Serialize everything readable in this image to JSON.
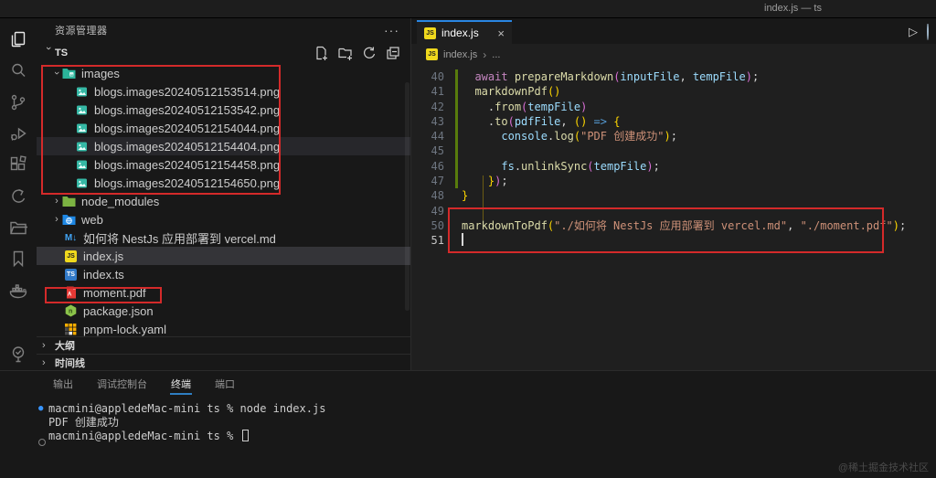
{
  "titlebar": {
    "title": "index.js — ts"
  },
  "activity_bar": {
    "items": [
      {
        "name": "explorer",
        "active": true
      },
      {
        "name": "search"
      },
      {
        "name": "source-control"
      },
      {
        "name": "run-debug"
      },
      {
        "name": "extensions"
      },
      {
        "name": "quick-back"
      },
      {
        "name": "project-manager"
      },
      {
        "name": "bookmarks"
      },
      {
        "name": "docker"
      },
      {
        "name": "todo-tree",
        "gap": true
      }
    ]
  },
  "sidebar": {
    "header": "资源管理器",
    "more_icon": "···",
    "section_label": "TS",
    "section_actions": [
      "new-file-icon",
      "new-folder-icon",
      "refresh-icon",
      "collapse-all-icon"
    ],
    "tree": [
      {
        "label": "images",
        "icon": "folder-images",
        "level": 1,
        "chevron": "expanded"
      },
      {
        "label": "blogs.images20240512153514.png",
        "icon": "image",
        "level": 2
      },
      {
        "label": "blogs.images20240512153542.png",
        "icon": "image",
        "level": 2
      },
      {
        "label": "blogs.images20240512154044.png",
        "icon": "image",
        "level": 2
      },
      {
        "label": "blogs.images20240512154404.png",
        "icon": "image",
        "level": 2,
        "state": "hover"
      },
      {
        "label": "blogs.images20240512154458.png",
        "icon": "image",
        "level": 2
      },
      {
        "label": "blogs.images20240512154650.png",
        "icon": "image",
        "level": 2
      },
      {
        "label": "node_modules",
        "icon": "folder-node",
        "level": 1,
        "chevron": "collapsed"
      },
      {
        "label": "web",
        "icon": "folder-web",
        "level": 1,
        "chevron": "collapsed"
      },
      {
        "label": "如何将 NestJs 应用部署到 vercel.md",
        "icon": "markdown",
        "level": 1
      },
      {
        "label": "index.js",
        "icon": "js",
        "level": 1,
        "state": "selected"
      },
      {
        "label": "index.ts",
        "icon": "ts",
        "level": 1
      },
      {
        "label": "moment.pdf",
        "icon": "pdf",
        "level": 1
      },
      {
        "label": "package.json",
        "icon": "node-json",
        "level": 1
      },
      {
        "label": "pnpm-lock.yaml",
        "icon": "pnpm",
        "level": 1
      }
    ],
    "bottom_sections": [
      {
        "label": "大纲"
      },
      {
        "label": "时间线"
      }
    ]
  },
  "editor": {
    "tab": {
      "label": "index.js",
      "close": "×"
    },
    "breadcrumb": {
      "file": "index.js",
      "sep": "›",
      "rest": "..."
    },
    "code": {
      "lines": [
        {
          "n": 40,
          "indent": 1,
          "git": true,
          "tokens": [
            [
              "kw",
              "await "
            ],
            [
              "fn",
              "prepareMarkdown"
            ],
            [
              "b2",
              "("
            ],
            [
              "var",
              "inputFile"
            ],
            [
              "pun",
              ", "
            ],
            [
              "var",
              "tempFile"
            ],
            [
              "b2",
              ")"
            ],
            [
              "pun",
              ";"
            ]
          ]
        },
        {
          "n": 41,
          "indent": 1,
          "git": true,
          "tokens": [
            [
              "fn",
              "markdownPdf"
            ],
            [
              "b1",
              "()"
            ]
          ]
        },
        {
          "n": 42,
          "indent": 2,
          "git": true,
          "tokens": [
            [
              "pun",
              "."
            ],
            [
              "fn",
              "from"
            ],
            [
              "b2",
              "("
            ],
            [
              "var",
              "tempFile"
            ],
            [
              "b2",
              ")"
            ]
          ]
        },
        {
          "n": 43,
          "indent": 2,
          "git": true,
          "tokens": [
            [
              "pun",
              "."
            ],
            [
              "fn",
              "to"
            ],
            [
              "b2",
              "("
            ],
            [
              "var",
              "pdfFile"
            ],
            [
              "pun",
              ", "
            ],
            [
              "b1",
              "()"
            ],
            [
              "op",
              " => "
            ],
            [
              "b1",
              "{"
            ]
          ]
        },
        {
          "n": 44,
          "indent": 3,
          "git": true,
          "tokens": [
            [
              "var",
              "console"
            ],
            [
              "pun",
              "."
            ],
            [
              "fn",
              "log"
            ],
            [
              "b1",
              "("
            ],
            [
              "str",
              "\"PDF 创建成功\""
            ],
            [
              "b1",
              ")"
            ],
            [
              "pun",
              ";"
            ]
          ]
        },
        {
          "n": 45,
          "indent": 0,
          "git": true,
          "tokens": []
        },
        {
          "n": 46,
          "indent": 3,
          "git": true,
          "tokens": [
            [
              "var",
              "fs"
            ],
            [
              "pun",
              "."
            ],
            [
              "fn",
              "unlinkSync"
            ],
            [
              "b2",
              "("
            ],
            [
              "var",
              "tempFile"
            ],
            [
              "b2",
              ")"
            ],
            [
              "pun",
              ";"
            ]
          ]
        },
        {
          "n": 47,
          "indent": 2,
          "git": true,
          "tokens": [
            [
              "b1",
              "}"
            ],
            [
              "b2",
              ")"
            ],
            [
              "pun",
              ";"
            ]
          ]
        },
        {
          "n": 48,
          "indent": 0,
          "git": false,
          "tokens": [
            [
              "b1",
              "}"
            ]
          ]
        },
        {
          "n": 49,
          "indent": 0,
          "git": false,
          "tokens": []
        },
        {
          "n": 50,
          "indent": 0,
          "git": false,
          "tokens": [
            [
              "fn",
              "markdownToPdf"
            ],
            [
              "b1",
              "("
            ],
            [
              "str",
              "\"./如何将 NestJs 应用部署到 vercel.md\""
            ],
            [
              "pun",
              ", "
            ],
            [
              "str",
              "\"./moment.pdf\""
            ],
            [
              "b1",
              ")"
            ],
            [
              "pun",
              ";"
            ]
          ]
        },
        {
          "n": 51,
          "indent": 0,
          "git": false,
          "tokens": [],
          "cursor": true
        }
      ]
    }
  },
  "panel": {
    "tabs": [
      {
        "label": "输出"
      },
      {
        "label": "调试控制台"
      },
      {
        "label": "终端",
        "active": true
      },
      {
        "label": "端口"
      }
    ],
    "terminal": [
      {
        "marker": "run",
        "text": "macmini@appledeMac-mini ts % node index.js"
      },
      {
        "marker": null,
        "text": "PDF 创建成功"
      },
      {
        "marker": "hollow",
        "text": "macmini@appledeMac-mini ts % ",
        "cursor": true
      }
    ]
  },
  "watermark": "@稀土掘金技术社区",
  "colors": {
    "accent_blue": "#2986e2",
    "annotation_red": "#d42a2a",
    "git_added": "#587c0c"
  }
}
